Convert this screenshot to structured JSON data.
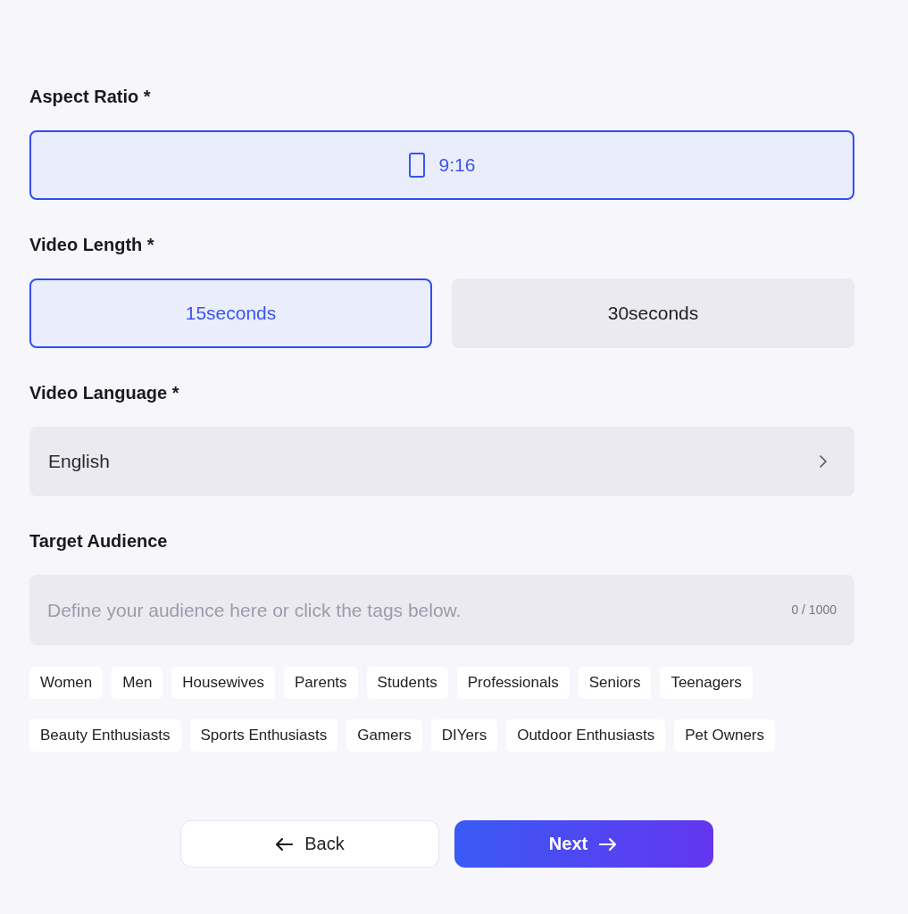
{
  "aspect_ratio": {
    "label": "Aspect Ratio *",
    "options": [
      {
        "label": "9:16",
        "selected": true
      }
    ]
  },
  "video_length": {
    "label": "Video Length *",
    "options": [
      {
        "label": "15seconds",
        "selected": true
      },
      {
        "label": "30seconds",
        "selected": false
      }
    ]
  },
  "video_language": {
    "label": "Video Language *",
    "value": "English"
  },
  "target_audience": {
    "label": "Target Audience",
    "placeholder": "Define your audience here or click the tags below.",
    "counter": "0 / 1000",
    "tags": [
      [
        "Women",
        "Men",
        "Housewives",
        "Parents",
        "Students",
        "Professionals",
        "Seniors",
        "Teenagers"
      ],
      [
        "Beauty Enthusiasts",
        "Sports Enthusiasts",
        "Gamers",
        "DIYers",
        "Outdoor Enthusiasts",
        "Pet Owners"
      ]
    ]
  },
  "buttons": [
    {
      "label": "Back",
      "kind": "secondary"
    },
    {
      "label": "Next",
      "kind": "primary"
    }
  ]
}
